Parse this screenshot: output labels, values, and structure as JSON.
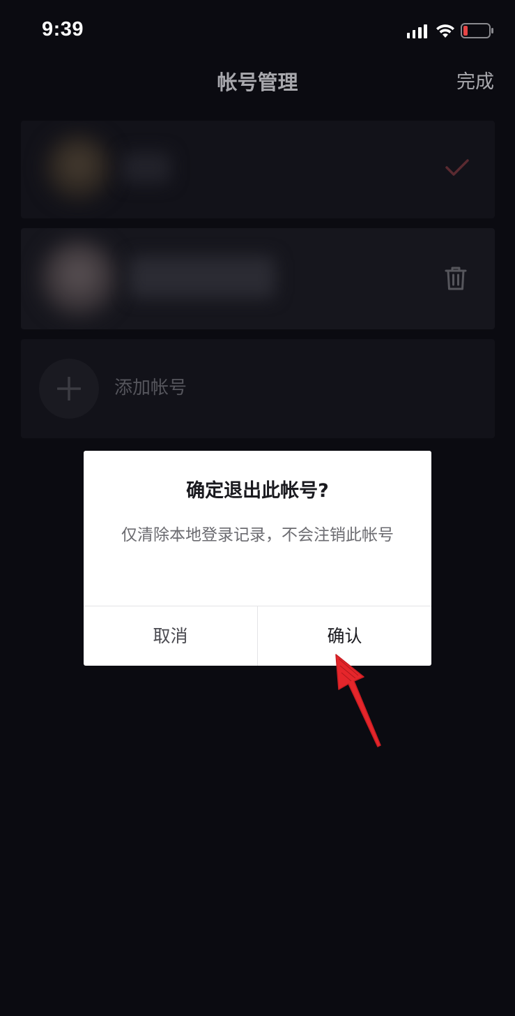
{
  "status_bar": {
    "time": "9:39",
    "icons": [
      "signal-icon",
      "wifi-icon",
      "battery-icon"
    ],
    "battery_color": "#e54545"
  },
  "header": {
    "title": "帐号管理",
    "done_label": "完成"
  },
  "accounts": {
    "current_account": {
      "selected": true,
      "check_color": "#c3323d"
    },
    "other_account": {
      "action_icon": "trash-icon"
    },
    "add_account_label": "添加帐号"
  },
  "dialog": {
    "title": "确定退出此帐号?",
    "message": "仅清除本地登录记录，不会注销此帐号",
    "cancel_label": "取消",
    "confirm_label": "确认"
  },
  "annotation": {
    "arrow_color": "#e5262b"
  }
}
